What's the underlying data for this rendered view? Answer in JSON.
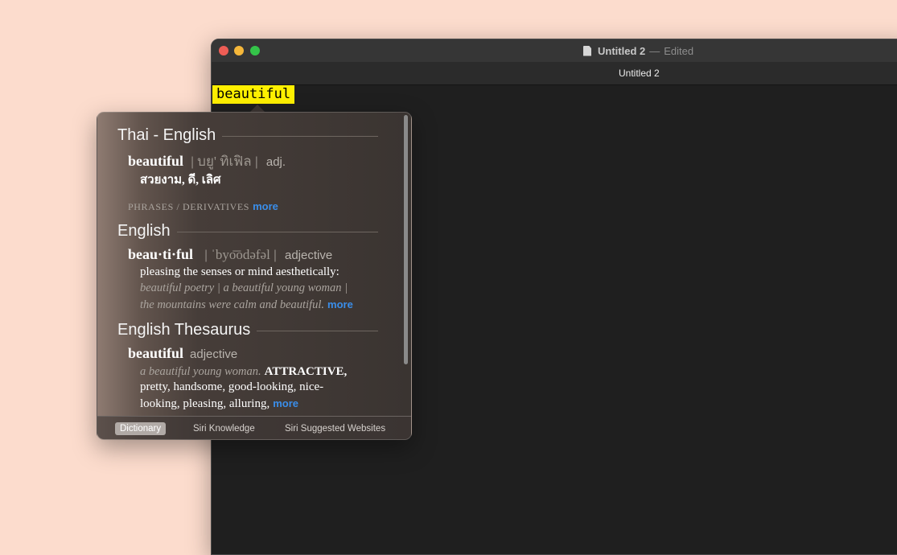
{
  "window": {
    "title": "Untitled 2",
    "title_separator": "—",
    "title_status": "Edited",
    "tab_label": "Untitled 2",
    "highlighted_word": "beautiful"
  },
  "popover": {
    "sections": {
      "thai": {
        "heading": "Thai - English",
        "headword": "beautiful",
        "pipe1": "|",
        "pronunciation": "บยู' ทิเฟิล",
        "pipe2": "|",
        "pos": "adj.",
        "translation": "สวยงาม, ดี, เลิศ",
        "phrases_label": "Phrases / Derivatives",
        "more": "more"
      },
      "english": {
        "heading": "English",
        "headword": "beau·ti·ful",
        "pipe1": "|",
        "pronunciation": "ˈbyo͞odəfəl",
        "pipe2": "|",
        "pos": "adjective",
        "definition": "pleasing the senses or mind aesthetically:",
        "example1": "beautiful poetry | a beautiful young woman |",
        "example2": "the mountains were calm and beautiful.",
        "more": "more"
      },
      "thesaurus": {
        "heading": "English Thesaurus",
        "headword": "beautiful",
        "pos": "adjective",
        "example": "a beautiful young woman.",
        "main_synonym": "ATTRACTIVE,",
        "synonyms_line2": "pretty, handsome, good-looking, nice-",
        "synonyms_line3": "looking, pleasing, alluring,",
        "more": "more"
      }
    },
    "footer_tabs": [
      "Dictionary",
      "Siri Knowledge",
      "Siri Suggested Websites"
    ],
    "active_tab": "Dictionary"
  },
  "colors": {
    "background": "#fcdccd",
    "highlight": "#fff000",
    "link": "#3a8eea"
  }
}
